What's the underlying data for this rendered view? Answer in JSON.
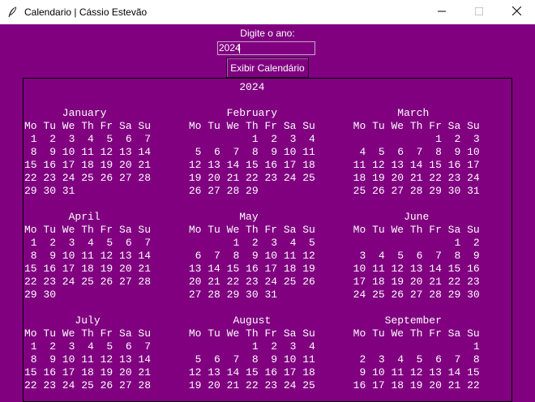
{
  "window": {
    "title": "Calendario | Cássio Estevão",
    "app_icon": "feather-icon",
    "buttons": {
      "minimize": "minimize-icon",
      "maximize": "maximize-icon",
      "close": "close-icon"
    }
  },
  "form": {
    "prompt_label": "Digite o ano:",
    "year_value": "2024",
    "submit_label": "Exibir Calendário"
  },
  "calendar_text": "                                  2024\n\n      January                   February                   March\nMo Tu We Th Fr Sa Su      Mo Tu We Th Fr Sa Su      Mo Tu We Th Fr Sa Su\n 1  2  3  4  5  6  7                1  2  3  4                   1  2  3\n 8  9 10 11 12 13 14       5  6  7  8  9 10 11       4  5  6  7  8  9 10\n15 16 17 18 19 20 21      12 13 14 15 16 17 18      11 12 13 14 15 16 17\n22 23 24 25 26 27 28      19 20 21 22 23 24 25      18 19 20 21 22 23 24\n29 30 31                  26 27 28 29               25 26 27 28 29 30 31\n\n       April                      May                       June\nMo Tu We Th Fr Sa Su      Mo Tu We Th Fr Sa Su      Mo Tu We Th Fr Sa Su\n 1  2  3  4  5  6  7             1  2  3  4  5                      1  2\n 8  9 10 11 12 13 14       6  7  8  9 10 11 12       3  4  5  6  7  8  9\n15 16 17 18 19 20 21      13 14 15 16 17 18 19      10 11 12 13 14 15 16\n22 23 24 25 26 27 28      20 21 22 23 24 25 26      17 18 19 20 21 22 23\n29 30                     27 28 29 30 31            24 25 26 27 28 29 30\n\n        July                     August                  September\nMo Tu We Th Fr Sa Su      Mo Tu We Th Fr Sa Su      Mo Tu We Th Fr Sa Su\n 1  2  3  4  5  6  7                1  2  3  4                         1\n 8  9 10 11 12 13 14       5  6  7  8  9 10 11       2  3  4  5  6  7  8\n15 16 17 18 19 20 21      12 13 14 15 16 17 18       9 10 11 12 13 14 15\n22 23 24 25 26 27 28      19 20 21 22 23 24 25      16 17 18 19 20 21 22",
  "colors": {
    "background": "#800080",
    "text": "#ffffff",
    "titlebar": "#ffffff"
  }
}
